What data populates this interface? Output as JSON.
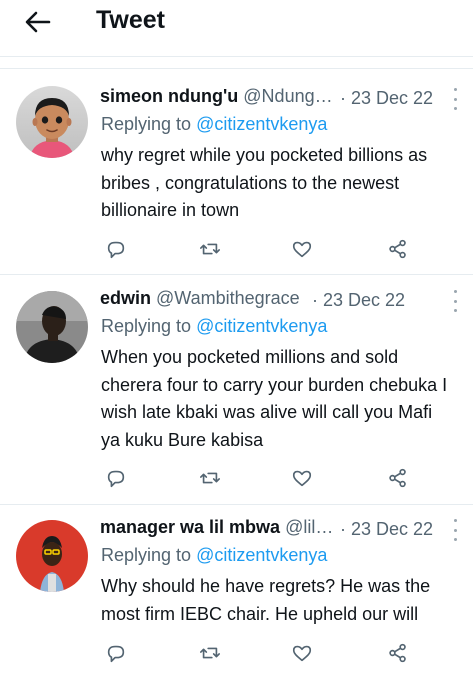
{
  "header": {
    "title": "Tweet"
  },
  "tweets": [
    {
      "name": "simeon ndung'u",
      "handle": "@Ndung…",
      "date": "· 23 Dec 22",
      "replying_prefix": "Replying to",
      "replying_to": "@citizentvkenya",
      "body": "why regret while you pocketed billions  as bribes , congratulations  to the newest billionaire in town"
    },
    {
      "name": "edwin",
      "handle": "@Wambithegrace",
      "date": "· 23 Dec 22",
      "replying_prefix": "Replying to",
      "replying_to": "@citizentvkenya",
      "body": "When you pocketed millions and sold cherera four to carry your burden chebuka I wish late kbaki was alive will call you Mafi ya kuku Bure kabisa"
    },
    {
      "name": "manager wa lil mbwa",
      "handle": "@lil…",
      "date": "· 23 Dec 22",
      "replying_prefix": "Replying to",
      "replying_to": "@citizentvkenya",
      "body": "Why should he have regrets? He was the most firm IEBC chair. He upheld our will"
    }
  ],
  "icons": {
    "back": "arrow-left-icon",
    "reply": "reply-bubble-icon",
    "retweet": "retweet-icon",
    "like": "heart-icon",
    "share": "share-icon",
    "more": "more-vertical-icon"
  },
  "colors": {
    "text": "#0f1419",
    "secondary": "#536471",
    "mention": "#1d9bf0",
    "separator": "#e6ecf0"
  }
}
